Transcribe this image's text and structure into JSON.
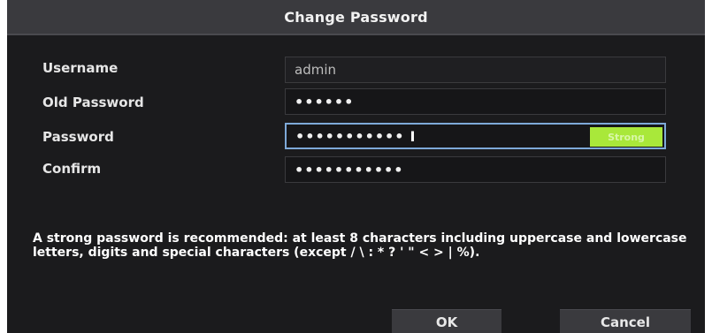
{
  "dialog": {
    "title": "Change Password",
    "fields": [
      {
        "label": "Username",
        "value": "admin"
      },
      {
        "label": "Old Password",
        "value": "••••••"
      },
      {
        "label": "Password",
        "value": "•••••••••••",
        "strength_label": "Strong"
      },
      {
        "label": "Confirm",
        "value": "•••••••••••"
      }
    ],
    "hint": "A strong password is recommended: at least 8 characters including uppercase and lowercase letters, digits and special characters (except / \\ : * ? ' \" < > | %).",
    "buttons": {
      "ok": "OK",
      "cancel": "Cancel"
    },
    "colors": {
      "strength": "#a9e83a",
      "focus_border": "#7ea9d8"
    }
  }
}
